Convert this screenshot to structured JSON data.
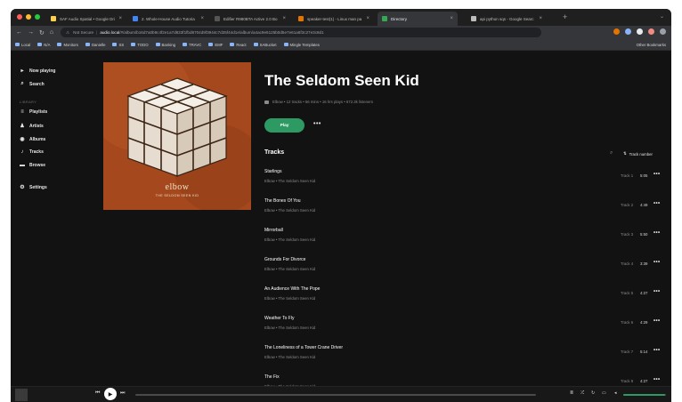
{
  "browser": {
    "tabs": [
      {
        "title": "SAF Audio Spatial • Google Dri",
        "fav": "#ffd04b"
      },
      {
        "title": "2. Whole-House Audio Tutoria",
        "fav": "#4285f4"
      },
      {
        "title": "Edifier R980BTA Active 2.0 Bo",
        "fav": "#555555"
      },
      {
        "title": "speaker-test(1) - Linux man pa",
        "fav": "#e37400"
      },
      {
        "title": "Directory",
        "fav": "#35a853"
      },
      {
        "title": "api python sqs - Google Searc",
        "fav": "#bdbdbd"
      }
    ],
    "url_prefix": "Not Secure",
    "url_host": "audio.local",
    "url_rest": "/#/album/b16d7a0b9c4f2e1a7d833f1fbd8704d9f3944c7d25f44d1e/album/a4ac9e5125b0d5e7e61a6f3c27e3c8d1",
    "bookmarks": [
      "Local",
      "N/A",
      "Monitors",
      "Danielle",
      "SS",
      "TODO",
      "Banking",
      "TRAVC",
      "EMF",
      "React",
      "SABucket",
      "Mingle Templates"
    ],
    "other_bookmarks": "Other Bookmarks",
    "extension_colors": [
      "#e37400",
      "#8ab4f8",
      "#e8eaed",
      "#f28b82",
      "#9aa0a6"
    ]
  },
  "sidebar": {
    "now_playing": "Now playing",
    "search": "Search",
    "section": "LIBRARY",
    "items": [
      "Playlists",
      "Artists",
      "Albums",
      "Tracks",
      "Browse"
    ],
    "settings": "Settings"
  },
  "album": {
    "title": "The Seldom Seen Kid",
    "meta": "Elbow • 12 tracks • 56 mins • 16 hrs plays • 672.3k listeners",
    "cover_band": "elbow",
    "cover_title": "THE SELDOM SEEN KID",
    "play_label": "Play"
  },
  "tracks_section": {
    "header": "Tracks",
    "sort_label": "Track number"
  },
  "tracks": [
    {
      "name": "Starlings",
      "sub": "Elbow • The Seldom Seen Kid",
      "num": "Track 1",
      "dur": "5:05"
    },
    {
      "name": "The Bones Of You",
      "sub": "Elbow • The Seldom Seen Kid",
      "num": "Track 2",
      "dur": "4:49"
    },
    {
      "name": "Mirrorball",
      "sub": "Elbow • The Seldom Seen Kid",
      "num": "Track 3",
      "dur": "5:50"
    },
    {
      "name": "Grounds For Divorce",
      "sub": "Elbow • The Seldom Seen Kid",
      "num": "Track 4",
      "dur": "3:39"
    },
    {
      "name": "An Audience With The Pope",
      "sub": "Elbow • The Seldom Seen Kid",
      "num": "Track 5",
      "dur": "4:27"
    },
    {
      "name": "Weather To Fly",
      "sub": "Elbow • The Seldom Seen Kid",
      "num": "Track 6",
      "dur": "4:29"
    },
    {
      "name": "The Loneliness of a Tower Crane Driver",
      "sub": "Elbow • The Seldom Seen Kid",
      "num": "Track 7",
      "dur": "5:14"
    },
    {
      "name": "The Fix",
      "sub": "Elbow • The Seldom Seen Kid",
      "num": "Track 8",
      "dur": "4:27"
    }
  ],
  "player": {
    "progress": 0.0,
    "volume": 0.98
  },
  "colors": {
    "accent": "#2d9a63",
    "background": "#121212",
    "cover": "#a5481d"
  }
}
